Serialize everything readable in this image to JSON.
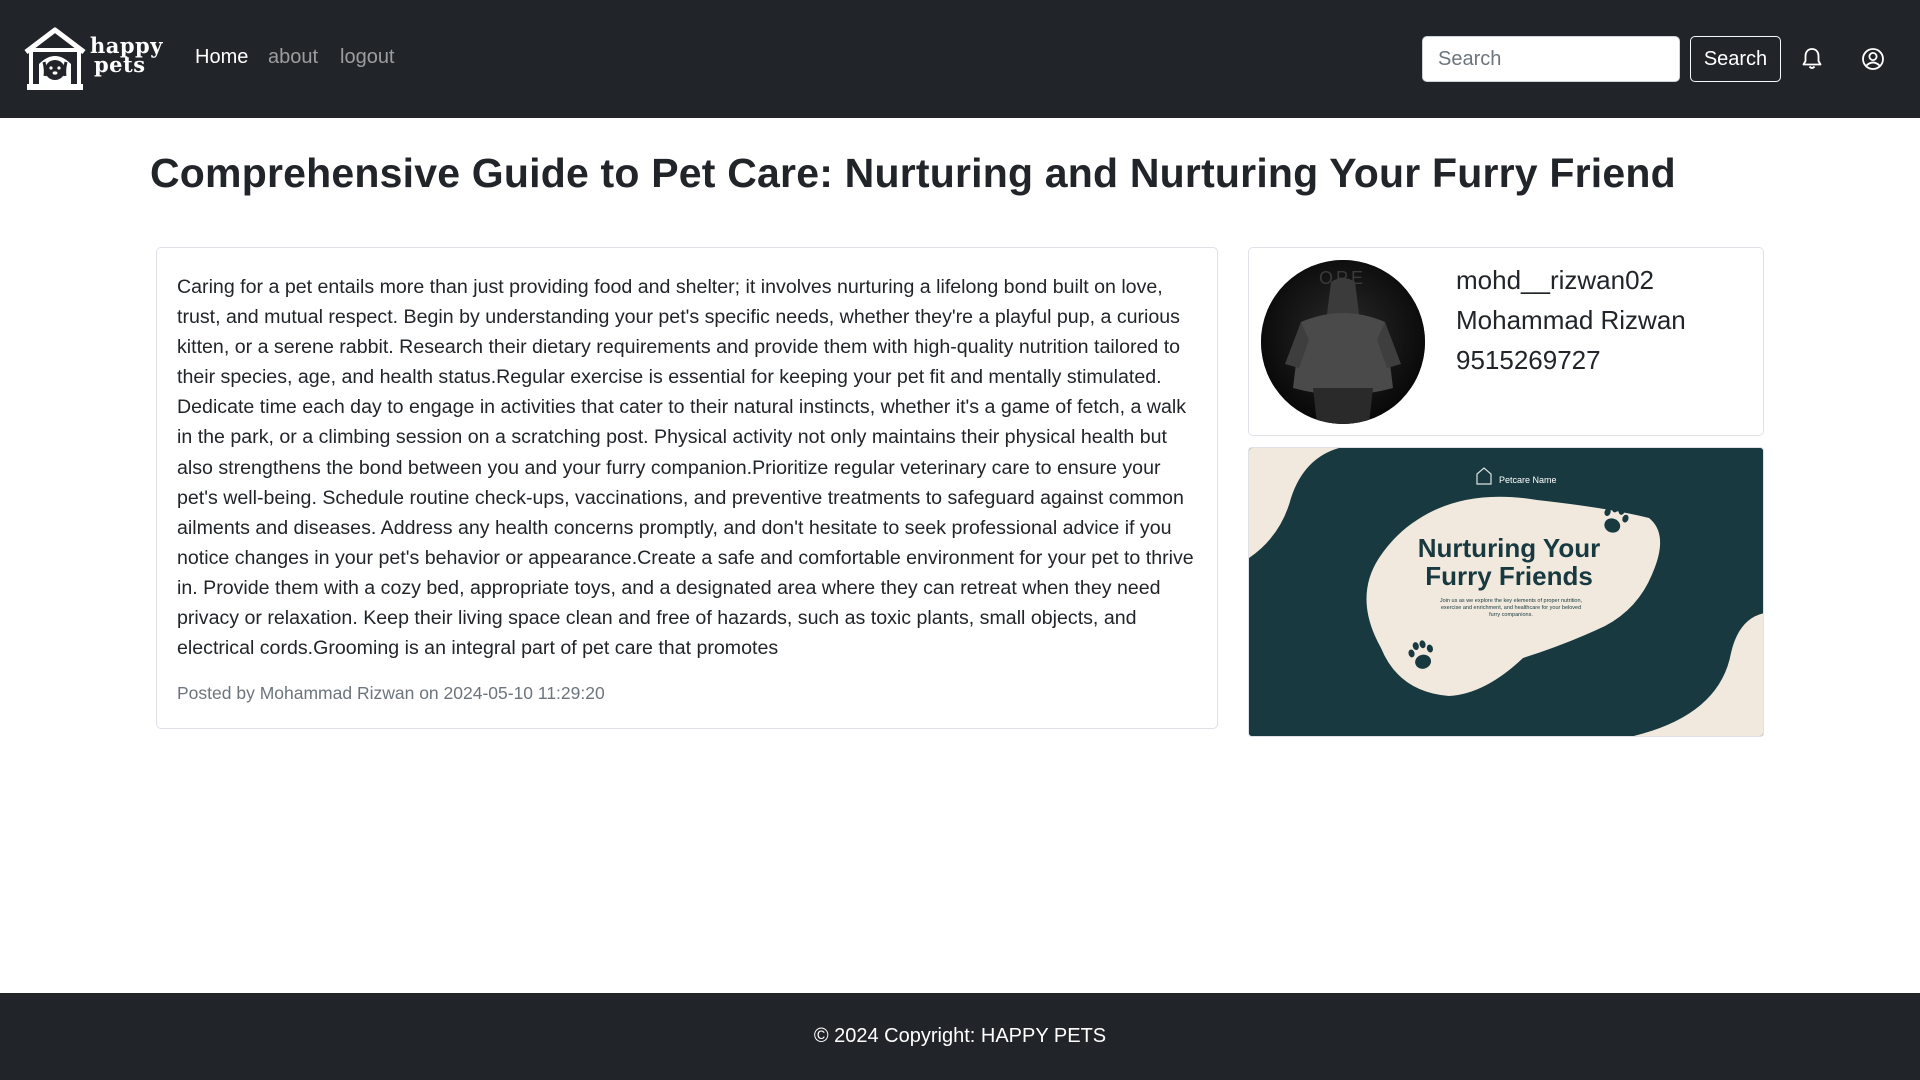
{
  "navbar": {
    "brand": {
      "line1": "happy",
      "line2": "pets"
    },
    "links": [
      {
        "label": "Home",
        "active": true
      },
      {
        "label": "about",
        "active": false
      },
      {
        "label": "logout",
        "active": false
      }
    ],
    "search": {
      "placeholder": "Search",
      "value": "",
      "button_label": "Search"
    },
    "icons": [
      "bell-icon",
      "user-circle-icon"
    ]
  },
  "post": {
    "title": "Comprehensive Guide to Pet Care: Nurturing and Nurturing Your Furry Friend",
    "body": "Caring for a pet entails more than just providing food and shelter; it involves nurturing a lifelong bond built on love, trust, and mutual respect. Begin by understanding your pet's specific needs, whether they're a playful pup, a curious kitten, or a serene rabbit. Research their dietary requirements and provide them with high-quality nutrition tailored to their species, age, and health status.Regular exercise is essential for keeping your pet fit and mentally stimulated. Dedicate time each day to engage in activities that cater to their natural instincts, whether it's a game of fetch, a walk in the park, or a climbing session on a scratching post. Physical activity not only maintains their physical health but also strengthens the bond between you and your furry companion.Prioritize regular veterinary care to ensure your pet's well-being. Schedule routine check-ups, vaccinations, and preventive treatments to safeguard against common ailments and diseases. Address any health concerns promptly, and don't hesitate to seek professional advice if you notice changes in your pet's behavior or appearance.Create a safe and comfortable environment for your pet to thrive in. Provide them with a cozy bed, appropriate toys, and a designated area where they can retreat when they need privacy or relaxation. Keep their living space clean and free of hazards, such as toxic plants, small objects, and electrical cords.Grooming is an integral part of pet care that promotes",
    "meta": "Posted by Mohammad Rizwan on 2024-05-10 11:29:20"
  },
  "profile": {
    "username": "mohd__rizwan02",
    "full_name": "Mohammad Rizwan",
    "phone": "9515269727",
    "avatar_text": "OPE"
  },
  "banner": {
    "brand": "Petcare Name",
    "headline_line1": "Nurturing Your",
    "headline_line2": "Furry Friends",
    "subtext_line1": "Join us as we explore the key elements of proper nutrition,",
    "subtext_line2": "exercise and enrichment, and healthcare for your beloved",
    "subtext_line3": "furry companions.",
    "colors": {
      "background": "#17393f",
      "blob": "#f1e9dd",
      "text": "#17393f"
    }
  },
  "footer": {
    "text": "© 2024 Copyright: HAPPY PETS"
  },
  "colors": {
    "navbar": "#212529",
    "footer": "#212529",
    "card_border": "#dee2e6",
    "muted_text": "#6c757d"
  }
}
